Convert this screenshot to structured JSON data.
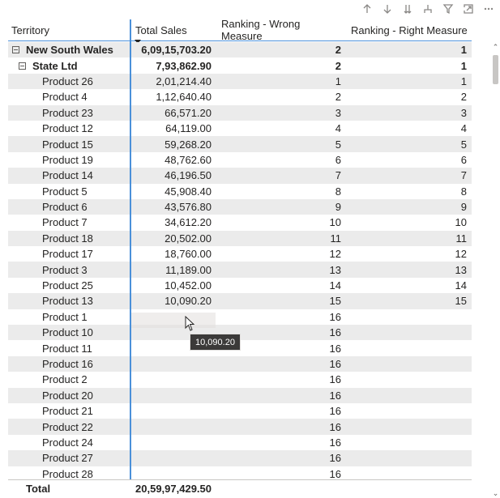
{
  "toolbar": {
    "icons": [
      "arrow-up-icon",
      "arrow-down-icon",
      "double-arrow-down-icon",
      "expand-hierarchy-icon",
      "filter-icon",
      "focus-mode-icon",
      "more-options-icon"
    ]
  },
  "table": {
    "headers": {
      "territory": "Territory",
      "total_sales": "Total Sales",
      "ranking_wrong": "Ranking - Wrong Measure",
      "ranking_right": "Ranking - Right Measure"
    },
    "rows": [
      {
        "label": "New South Wales",
        "level": 0,
        "bold": true,
        "expander": true,
        "sales": "6,09,15,703.20",
        "wrong": "2",
        "right": "1"
      },
      {
        "label": "State Ltd",
        "level": 1,
        "bold": true,
        "expander": true,
        "sales": "7,93,862.90",
        "wrong": "2",
        "right": "1"
      },
      {
        "label": "Product 26",
        "level": 2,
        "sales": "2,01,214.40",
        "wrong": "1",
        "right": "1"
      },
      {
        "label": "Product 4",
        "level": 2,
        "sales": "1,12,640.40",
        "wrong": "2",
        "right": "2"
      },
      {
        "label": "Product 23",
        "level": 2,
        "sales": "66,571.20",
        "wrong": "3",
        "right": "3"
      },
      {
        "label": "Product 12",
        "level": 2,
        "sales": "64,119.00",
        "wrong": "4",
        "right": "4"
      },
      {
        "label": "Product 15",
        "level": 2,
        "sales": "59,268.20",
        "wrong": "5",
        "right": "5"
      },
      {
        "label": "Product 19",
        "level": 2,
        "sales": "48,762.60",
        "wrong": "6",
        "right": "6"
      },
      {
        "label": "Product 14",
        "level": 2,
        "sales": "46,196.50",
        "wrong": "7",
        "right": "7"
      },
      {
        "label": "Product 5",
        "level": 2,
        "sales": "45,908.40",
        "wrong": "8",
        "right": "8"
      },
      {
        "label": "Product 6",
        "level": 2,
        "sales": "43,576.80",
        "wrong": "9",
        "right": "9"
      },
      {
        "label": "Product 7",
        "level": 2,
        "sales": "34,612.20",
        "wrong": "10",
        "right": "10"
      },
      {
        "label": "Product 18",
        "level": 2,
        "sales": "20,502.00",
        "wrong": "11",
        "right": "11"
      },
      {
        "label": "Product 17",
        "level": 2,
        "sales": "18,760.00",
        "wrong": "12",
        "right": "12"
      },
      {
        "label": "Product 3",
        "level": 2,
        "sales": "11,189.00",
        "wrong": "13",
        "right": "13"
      },
      {
        "label": "Product 25",
        "level": 2,
        "sales": "10,452.00",
        "wrong": "14",
        "right": "14"
      },
      {
        "label": "Product 13",
        "level": 2,
        "sales": "10,090.20",
        "wrong": "15",
        "right": "15"
      },
      {
        "label": "Product 1",
        "level": 2,
        "sales": "",
        "wrong": "16",
        "right": ""
      },
      {
        "label": "Product 10",
        "level": 2,
        "sales": "",
        "wrong": "16",
        "right": ""
      },
      {
        "label": "Product 11",
        "level": 2,
        "sales": "",
        "wrong": "16",
        "right": ""
      },
      {
        "label": "Product 16",
        "level": 2,
        "sales": "",
        "wrong": "16",
        "right": ""
      },
      {
        "label": "Product 2",
        "level": 2,
        "sales": "",
        "wrong": "16",
        "right": ""
      },
      {
        "label": "Product 20",
        "level": 2,
        "sales": "",
        "wrong": "16",
        "right": ""
      },
      {
        "label": "Product 21",
        "level": 2,
        "sales": "",
        "wrong": "16",
        "right": ""
      },
      {
        "label": "Product 22",
        "level": 2,
        "sales": "",
        "wrong": "16",
        "right": ""
      },
      {
        "label": "Product 24",
        "level": 2,
        "sales": "",
        "wrong": "16",
        "right": ""
      },
      {
        "label": "Product 27",
        "level": 2,
        "sales": "",
        "wrong": "16",
        "right": ""
      },
      {
        "label": "Product 28",
        "level": 2,
        "sales": "",
        "wrong": "16",
        "right": ""
      }
    ],
    "total": {
      "label": "Total",
      "sales": "20,59,97,429.50"
    }
  },
  "tooltip": {
    "text": "10,090.20"
  }
}
